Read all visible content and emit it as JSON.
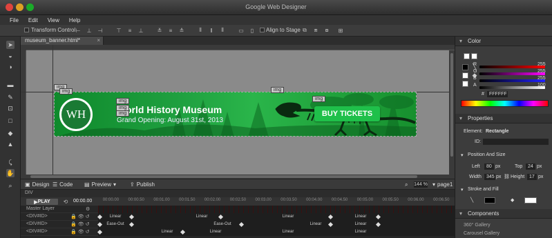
{
  "window": {
    "title": "Google Web Designer"
  },
  "menu": [
    "File",
    "Edit",
    "View",
    "Help"
  ],
  "toolbar": {
    "transform_control_label": "Transform Control",
    "align_to_stage_label": "Align to Stage"
  },
  "document": {
    "tab_name": "museum_banner.html*",
    "tab_close": "×"
  },
  "banner": {
    "logo_text": "WH",
    "title": "World History Museum",
    "subtitle": "Grand Opening: August 31st, 2013",
    "cta": "BUY TICKETS"
  },
  "img_tags": [
    "img",
    "img",
    "img",
    "img",
    "img",
    "img",
    "img"
  ],
  "bottom_toolbar": {
    "design": "Design",
    "code": "Code",
    "preview": "Preview",
    "publish": "Publish",
    "zoom": "144 %",
    "page": "page1"
  },
  "timeline": {
    "header": "DIV",
    "play_label": "PLAY",
    "current_time": "00:00.00",
    "ticks": [
      "00:00.00",
      "00:00.50",
      "00:01.00",
      "00:01.50",
      "00:02.00",
      "00:02.50",
      "00:03.00",
      "00:03.50",
      "00:04.00",
      "00:04.50",
      "00:05.00",
      "00:05.50",
      "00:06.00",
      "00:06.50"
    ],
    "master_layer": "Master Layer",
    "rows": [
      {
        "name": "<DIV#ID>",
        "segments": [
          "Linear",
          "Linear",
          "Linear",
          "Linear"
        ]
      },
      {
        "name": "<DIV#ID>",
        "segments": [
          "Ease-Out",
          "Ease-Out",
          "Linear",
          "Linear"
        ]
      },
      {
        "name": "<DIV#ID>",
        "segments": [
          "Linear",
          "Linear",
          "Linear",
          "Linear"
        ]
      }
    ]
  },
  "color_panel": {
    "title": "Color",
    "channels": [
      {
        "label": "R",
        "value": "255",
        "color": "#ff2020"
      },
      {
        "label": "G",
        "value": "255",
        "color": "#ff40ff"
      },
      {
        "label": "B",
        "value": "255",
        "color": "#2020ff"
      },
      {
        "label": "A",
        "value": "100",
        "color": "#ffffff"
      }
    ],
    "hex_label": "#",
    "hex_value": "FFFFFF"
  },
  "properties_panel": {
    "title": "Properties",
    "element_label": "Element:",
    "element_value": "Rectangle",
    "id_label": "ID:",
    "position_size_label": "Position And Size",
    "left_label": "Left",
    "left_value": "80",
    "top_label": "Top",
    "top_value": "24",
    "width_label": "Width",
    "width_value": "345",
    "height_label": "Height",
    "height_value": "17",
    "unit": "px",
    "stroke_fill_label": "Stroke and Fill"
  },
  "components_panel": {
    "title": "Components",
    "items": [
      "360° Gallery",
      "Carousel Gallery"
    ]
  }
}
